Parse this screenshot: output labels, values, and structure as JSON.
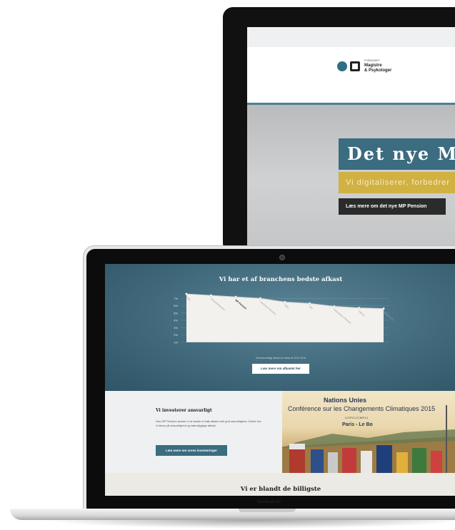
{
  "monitor": {
    "logo": {
      "small": "FORBUNDET",
      "line1": "Magistre",
      "line2": "& Psykologer"
    },
    "hero": {
      "title": "Det nye MP",
      "subtitle": "Vi digitaliserer, forbedrer",
      "button": "Læs mere om det nye MP Pension"
    }
  },
  "laptop": {
    "chart_section": {
      "title": "Vi har et af branchens bedste afkast",
      "footnote": "Gennemsnitligt afkast de sidste år 2011-2016",
      "button": "Læs mere om afkastet her"
    },
    "invest_section": {
      "title": "Vi investerer ansvarligt",
      "text": "Hos MP Pension ønsker vi at skabe et højt afkast med god samvittighed. Derfor har vi fokus på ansvarlighed og bæredygtige afkast.",
      "button": "Læs mere om vores investeringer"
    },
    "photo": {
      "line1": "Nations Unies",
      "line2": "Conférence sur les Changements Climatiques 2015",
      "line3": "COP21/CMP11",
      "line4": "Paris - Le Bo"
    },
    "bottom_section": {
      "title": "Vi er blandt de billigste"
    },
    "bezel_label": "MacBook Air"
  },
  "chart_data": {
    "type": "line",
    "categories": [
      "PKA",
      "Pensionskassen",
      "MP Pension",
      "Lærernes Pension",
      "PFA",
      "ISP",
      "Industriens Pension",
      "Danica",
      "Sampension"
    ],
    "values": [
      7.6,
      7.4,
      7.2,
      7.0,
      6.5,
      6.3,
      5.9,
      5.7,
      5.6
    ],
    "y_tick_labels": [
      "7%",
      "6%",
      "5%",
      "4%",
      "3%",
      "2%",
      "1%"
    ],
    "ylim": [
      0,
      8
    ],
    "highlight": "MP Pension",
    "line_color": "#d0d0d0",
    "area_color": "#f2f1ee"
  },
  "colors": {
    "teal": "#3b6c80",
    "gold": "#d1b142",
    "dark": "#2b2b2b"
  }
}
